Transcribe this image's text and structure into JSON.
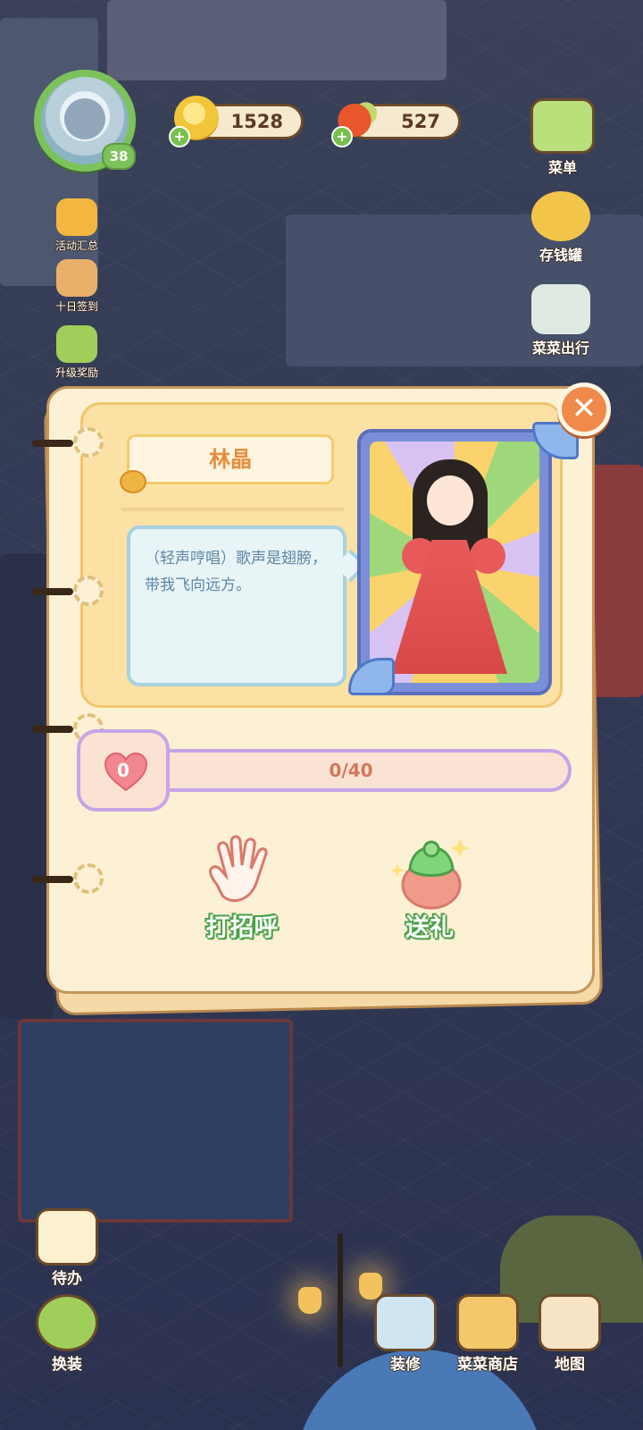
{
  "hud": {
    "level": "38",
    "coins": "1528",
    "vegetables": "527",
    "left_menu": [
      {
        "label": "活动汇总",
        "icon": "event-icon"
      },
      {
        "label": "十日签到",
        "icon": "checkin-icon"
      },
      {
        "label": "升级奖励",
        "icon": "levelup-reward-icon"
      }
    ],
    "right_menu": [
      {
        "label": "菜单",
        "icon": "menu-icon"
      },
      {
        "label": "存钱罐",
        "icon": "piggy-bank-icon"
      },
      {
        "label": "菜菜出行",
        "icon": "travel-icon"
      }
    ],
    "bottom_left": [
      {
        "label": "待办",
        "icon": "todo-icon"
      },
      {
        "label": "换装",
        "icon": "dressup-icon"
      }
    ],
    "bottom_right": [
      {
        "label": "装修",
        "icon": "decorate-icon"
      },
      {
        "label": "菜菜商店",
        "icon": "shop-icon"
      },
      {
        "label": "地图",
        "icon": "map-icon"
      }
    ]
  },
  "dialog": {
    "character_name": "林晶",
    "quote": "（轻声哼唱）歌声是翅膀，带我飞向远方。",
    "affection_level": "0",
    "affection_progress": "0/40",
    "affection_fraction": 0,
    "actions": [
      {
        "label": "打招呼",
        "icon": "wave-hand-icon"
      },
      {
        "label": "送礼",
        "icon": "gift-icon"
      }
    ],
    "close_symbol": "✕"
  },
  "colors": {
    "accent_orange": "#f08a4b",
    "affection_purple": "#c6a4e6",
    "action_green": "#4aa047"
  }
}
